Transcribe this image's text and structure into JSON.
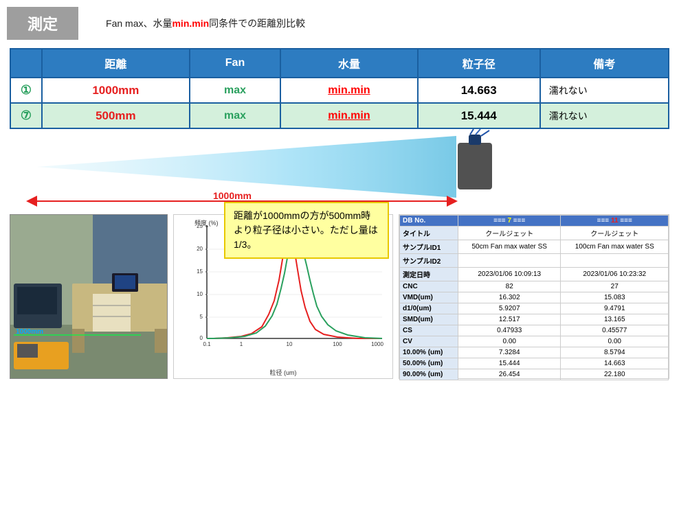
{
  "header": {
    "title": "測定",
    "subtitle": "Fan max、水量",
    "subtitle_red": "min.min",
    "subtitle_end": "同条件での距離別比較"
  },
  "table": {
    "headers": [
      "",
      "距離",
      "Fan",
      "水量",
      "粒子径",
      "備考"
    ],
    "rows": [
      {
        "num": "①",
        "distance": "1000mm",
        "fan": "max",
        "water": "min.min",
        "particle": "14.663",
        "remarks": "濡れない",
        "row_bg": "white"
      },
      {
        "num": "⑦",
        "distance": "500mm",
        "fan": "max",
        "water": "min.min",
        "particle": "15.444",
        "remarks": "濡れない",
        "row_bg": "green"
      }
    ]
  },
  "diagram": {
    "distance_label": "1000mm"
  },
  "comment": {
    "text": "距離が1000mmの方が500mm時より粒子径は小さい。ただし量は1/3。"
  },
  "photo": {
    "label": "1000mm"
  },
  "chart": {
    "y_label": "頻度 (%)",
    "x_label": "粒径 (um)",
    "y_ticks": [
      "25",
      "20",
      "15",
      "10",
      "5",
      "0"
    ],
    "x_ticks": [
      "0.1",
      "1",
      "10",
      "100",
      "1000"
    ]
  },
  "stats": {
    "db_label": "DB No.",
    "col7": "7",
    "col11": "11",
    "rows": [
      {
        "label": "タイトル",
        "v7": "クールジェット",
        "v11": "クールジェット"
      },
      {
        "label": "サンプルID1",
        "v7": "50cm Fan max water SS",
        "v11": "100cm Fan max water SS"
      },
      {
        "label": "サンプルID2",
        "v7": "",
        "v11": ""
      },
      {
        "label": "測定日時",
        "v7": "2023/01/06 10:09:13",
        "v11": "2023/01/06 10:23:32"
      },
      {
        "label": "CNC",
        "v7": "82",
        "v11": "27"
      },
      {
        "label": "VMD(um)",
        "v7": "16.302",
        "v11": "15.083"
      },
      {
        "label": "d1/0(um)",
        "v7": "5.9207",
        "v11": "9.4791"
      },
      {
        "label": "SMD(um)",
        "v7": "12.517",
        "v11": "13.165"
      },
      {
        "label": "CS",
        "v7": "0.47933",
        "v11": "0.45577"
      },
      {
        "label": "CV",
        "v7": "0.00",
        "v11": "0.00"
      },
      {
        "label": "10.00% (um)",
        "v7": "7.3284",
        "v11": "8.5794"
      },
      {
        "label": "50.00% (um)",
        "v7": "15.444",
        "v11": "14.663"
      },
      {
        "label": "90.00% (um)",
        "v7": "26.454",
        "v11": "22.180"
      }
    ]
  }
}
